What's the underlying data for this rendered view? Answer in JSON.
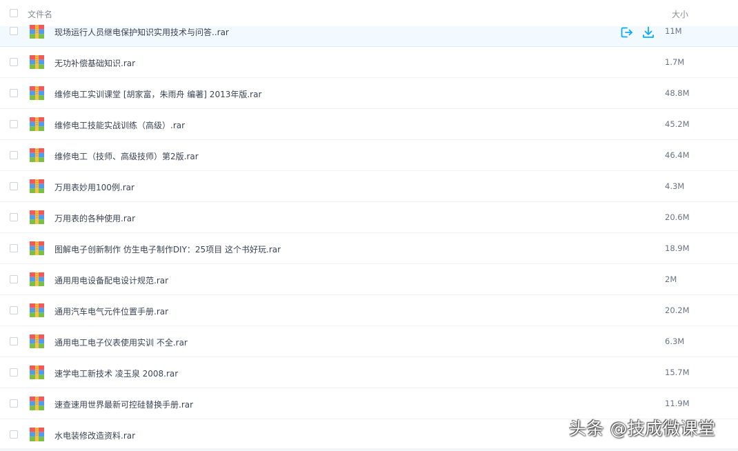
{
  "header": {
    "name_label": "文件名",
    "size_label": "大小"
  },
  "files": [
    {
      "name": "现场运行人员继电保护知识实用技术与问答..rar",
      "size": "11M"
    },
    {
      "name": "无功补偿基础知识.rar",
      "size": "1.7M"
    },
    {
      "name": "维修电工实训课堂 [胡家富，朱雨舟 编著] 2013年版.rar",
      "size": "48.8M"
    },
    {
      "name": "维修电工技能实战训练（高级）.rar",
      "size": "45.2M"
    },
    {
      "name": "维修电工（技师、高级技师）第2版.rar",
      "size": "46.4M"
    },
    {
      "name": "万用表妙用100例.rar",
      "size": "4.3M"
    },
    {
      "name": "万用表的各种使用.rar",
      "size": "20.6M"
    },
    {
      "name": "图解电子创新制作 仿生电子制作DIY：25项目 这个书好玩.rar",
      "size": "18.9M"
    },
    {
      "name": "通用用电设备配电设计规范.rar",
      "size": "2M"
    },
    {
      "name": "通用汽车电气元件位置手册.rar",
      "size": "20.2M"
    },
    {
      "name": "通用电工电子仪表使用实训 不全.rar",
      "size": "6.3M"
    },
    {
      "name": "速学电工新技术 凌玉泉 2008.rar",
      "size": "15.7M"
    },
    {
      "name": "速查速用世界最新可控硅替换手册.rar",
      "size": "11.9M"
    },
    {
      "name": "水电装修改造资料.rar",
      "size": ""
    }
  ],
  "row_actions": {
    "share_icon": "share-icon",
    "download_icon": "download-icon"
  },
  "watermark": "头条 @技成微课堂",
  "colors": {
    "accent": "#09aaff",
    "hover_row": "#f2faff"
  }
}
